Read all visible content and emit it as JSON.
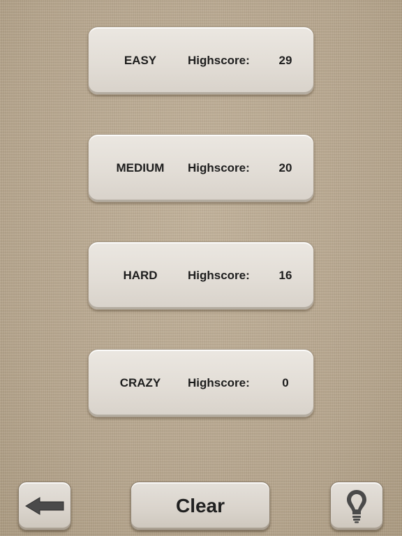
{
  "scores": [
    {
      "level": "EASY",
      "label": "Highscore:",
      "value": "29"
    },
    {
      "level": "MEDIUM",
      "label": "Highscore:",
      "value": "20"
    },
    {
      "level": "HARD",
      "label": "Highscore:",
      "value": "16"
    },
    {
      "level": "CRAZY",
      "label": "Highscore:",
      "value": "0"
    }
  ],
  "toolbar": {
    "back_icon": "arrow-left-icon",
    "clear_label": "Clear",
    "hint_icon": "lightbulb-icon"
  },
  "colors": {
    "background": "#b9a890",
    "panel": "#e4e0da",
    "text": "#1d1d1d"
  }
}
